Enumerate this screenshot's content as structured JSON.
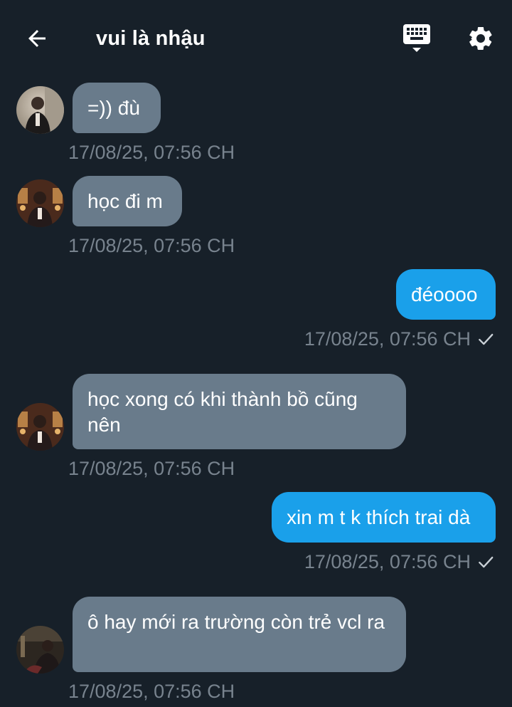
{
  "header": {
    "title": "vui là nhậu",
    "back_icon": "arrow-left-icon",
    "keyboard_icon": "keyboard-icon",
    "settings_icon": "gear-icon"
  },
  "colors": {
    "background": "#172029",
    "incoming_bubble": "#697b8b",
    "outgoing_bubble": "#1aa0ea",
    "timestamp": "#78838e"
  },
  "messages": [
    {
      "direction": "incoming",
      "text": "=)) đù",
      "time": "17/08/25, 07:56 CH"
    },
    {
      "direction": "incoming",
      "text": "học đi m",
      "time": "17/08/25, 07:56 CH"
    },
    {
      "direction": "outgoing",
      "text": "đéoooo",
      "time": "17/08/25, 07:56 CH",
      "status": "sent-check-icon"
    },
    {
      "direction": "incoming",
      "text": "học xong có khi thành bồ cũng nên",
      "time": "17/08/25, 07:56 CH"
    },
    {
      "direction": "outgoing",
      "text": "xin m t k thích trai dà",
      "time": "17/08/25, 07:56 CH",
      "status": "sent-check-icon"
    },
    {
      "direction": "incoming",
      "text": "ô hay mới ra trường còn trẻ vcl ra",
      "time": "17/08/25, 07:56 CH"
    }
  ]
}
